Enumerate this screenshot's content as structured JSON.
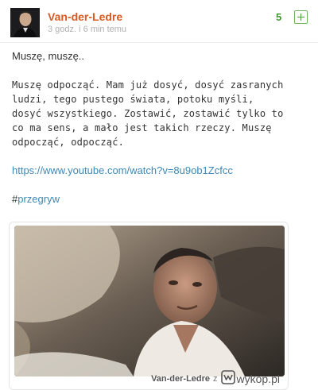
{
  "entry": {
    "author": "Van-der-Ledre",
    "time": "3 godz. i 6 min temu",
    "votes": "5",
    "vote_action": "plus",
    "paragraph1": "Muszę, muszę..",
    "paragraph2": "Muszę odpocząć. Mam już dosyć, dosyć zasranych\nludzi, tego pustego świata, potoku myśli,\ndosyć wszystkiego. Zostawić, zostawić tylko to\nco ma sens, a mało jest takich rzeczy. Muszę\nodpocząć, odpocząć.",
    "link": "https://www.youtube.com/watch?v=8u9ob1Zcfcc",
    "tag_hash": "#",
    "tag": "przegryw"
  },
  "embed": {
    "credit_author": "Van-der-Ledre",
    "credit_z": "z",
    "site": "wykop.pl",
    "logo_icon": "wykop-logo-icon"
  },
  "colors": {
    "author": "#d85b24",
    "link": "#3f88b6",
    "votes": "#3c9a29"
  }
}
